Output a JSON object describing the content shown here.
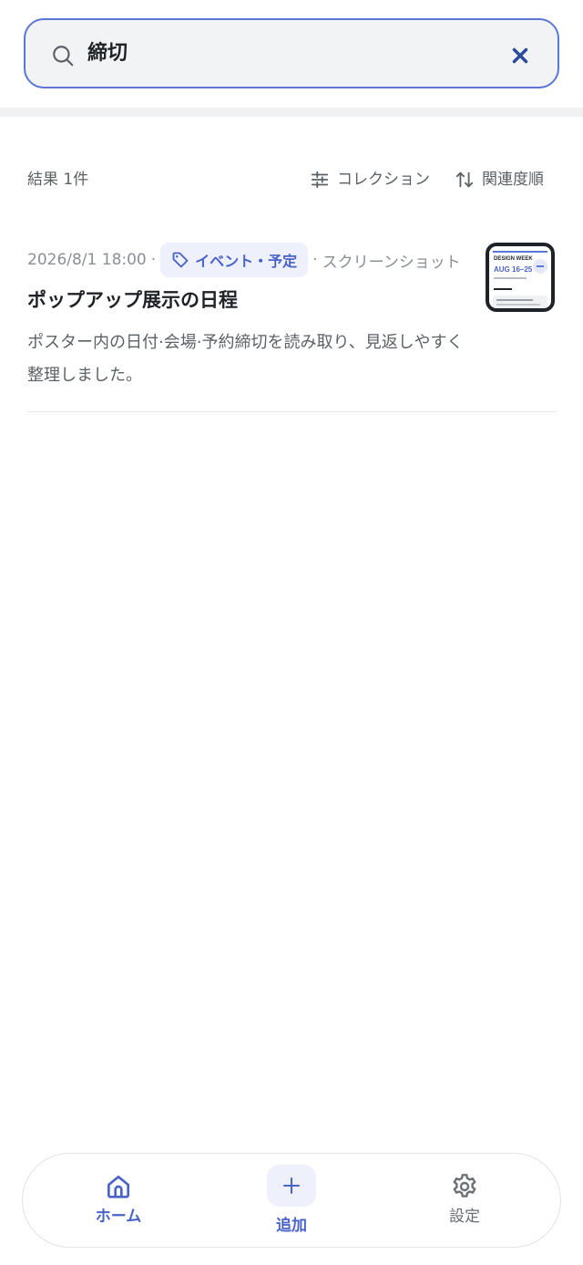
{
  "search": {
    "value": "締切",
    "icon": "search-icon",
    "clear_icon": "close-icon"
  },
  "results_header": {
    "count_label": "結果 1件",
    "collection_label": "コレクション",
    "sort_label": "関連度順"
  },
  "results": [
    {
      "date": "2026/8/1 18:00",
      "tag_label": "イベント・予定",
      "type_label": "スクリーンショット",
      "title": "ポップアップ展示の日程",
      "description": "ポスター内の日付·会場·予約締切を読み取り、見返しやすく整理しました。",
      "thumbnail": {
        "line1": "DESIGN WEEK",
        "line2": "AUG 16–25"
      }
    }
  ],
  "nav": {
    "home_label": "ホーム",
    "add_label": "追加",
    "settings_label": "設定"
  },
  "colors": {
    "accent": "#4a63c9",
    "search_border": "#5b76d6",
    "tag_bg": "#eef0fb",
    "muted_text": "#8a8f94"
  }
}
